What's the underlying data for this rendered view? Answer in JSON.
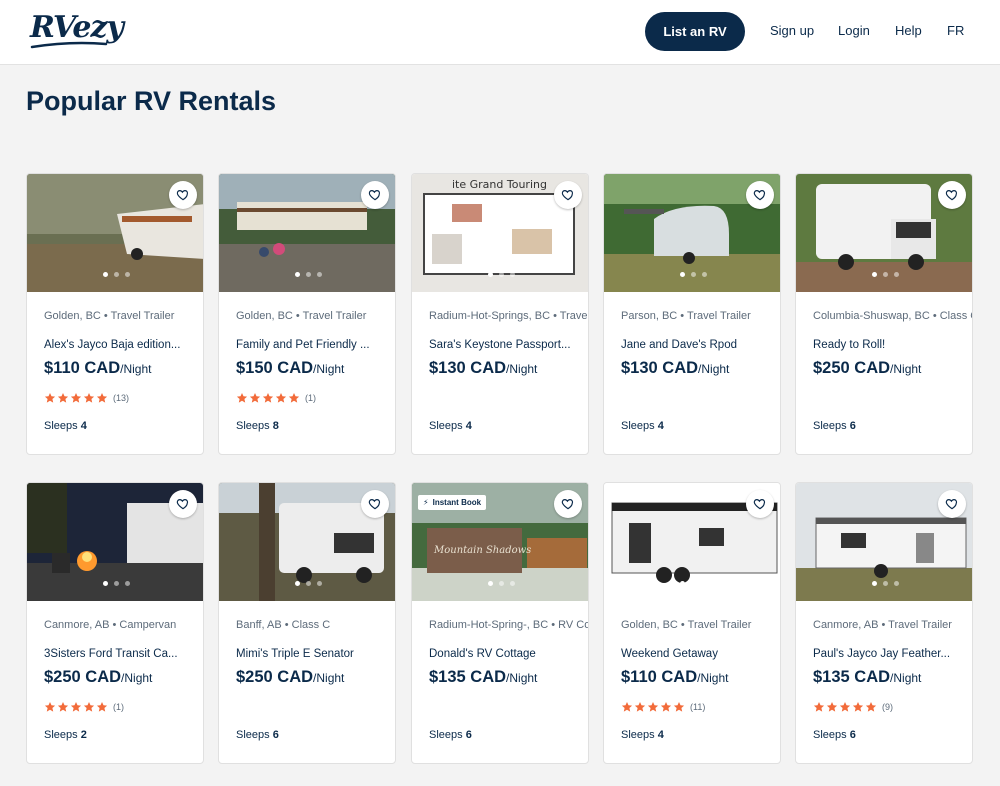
{
  "header": {
    "logo": "RVezy",
    "list_button": "List an RV",
    "nav": [
      {
        "label": "Sign up"
      },
      {
        "label": "Login"
      },
      {
        "label": "Help"
      },
      {
        "label": "FR"
      }
    ]
  },
  "page_title": "Popular RV Rentals",
  "per_night_label": "/Night",
  "sleeps_label": "Sleeps",
  "colors": {
    "brand_navy": "#0b2a4a",
    "star_orange": "#f26b3a",
    "background": "#f3f3f3"
  },
  "listings": [
    {
      "location": "Golden, BC • Travel Trailer",
      "name": "Alex's Jayco Baja edition...",
      "price": "$110 CAD",
      "rating_count": "(13)",
      "stars": 5,
      "sleeps": "4",
      "badge": "",
      "image": "trailer-in-forest"
    },
    {
      "location": "Golden, BC • Travel Trailer",
      "name": "Family and Pet Friendly ...",
      "price": "$150 CAD",
      "rating_count": "(1)",
      "stars": 5,
      "sleeps": "8",
      "badge": "",
      "image": "trailer-campsite"
    },
    {
      "location": "Radium-Hot-Springs, BC • Travel Trailer",
      "name": "Sara's Keystone Passport...",
      "price": "$130 CAD",
      "rating_count": "",
      "stars": 0,
      "sleeps": "4",
      "badge": "",
      "image": "floor-plan"
    },
    {
      "location": "Parson, BC • Travel Trailer",
      "name": "Jane and Dave's Rpod",
      "price": "$130 CAD",
      "rating_count": "",
      "stars": 0,
      "sleeps": "4",
      "badge": "",
      "image": "rpod-trailer"
    },
    {
      "location": "Columbia-Shuswap, BC • Class C",
      "name": "Ready to Roll!",
      "price": "$250 CAD",
      "rating_count": "",
      "stars": 0,
      "sleeps": "6",
      "badge": "",
      "image": "class-c-motorhome"
    },
    {
      "location": "Canmore, AB • Campervan",
      "name": "3Sisters Ford Transit Ca...",
      "price": "$250 CAD",
      "rating_count": "(1)",
      "stars": 5,
      "sleeps": "2",
      "badge": "",
      "image": "campfire-night"
    },
    {
      "location": "Banff, AB • Class C",
      "name": "Mimi's Triple E Senator",
      "price": "$250 CAD",
      "rating_count": "",
      "stars": 0,
      "sleeps": "6",
      "badge": "",
      "image": "class-c-in-trees"
    },
    {
      "location": "Radium-Hot-Spring-, BC • RV Cottage",
      "name": "Donald's RV Cottage",
      "price": "$135 CAD",
      "rating_count": "",
      "stars": 0,
      "sleeps": "6",
      "badge": "Instant Book",
      "image": "resort-sign"
    },
    {
      "location": "Golden, BC • Travel Trailer",
      "name": "Weekend Getaway",
      "price": "$110 CAD",
      "rating_count": "(11)",
      "stars": 5,
      "sleeps": "4",
      "badge": "",
      "image": "white-trailer"
    },
    {
      "location": "Canmore, AB • Travel Trailer",
      "name": "Paul's Jayco Jay Feather...",
      "price": "$135 CAD",
      "rating_count": "(9)",
      "stars": 5,
      "sleeps": "6",
      "badge": "",
      "image": "trailer-field"
    }
  ]
}
